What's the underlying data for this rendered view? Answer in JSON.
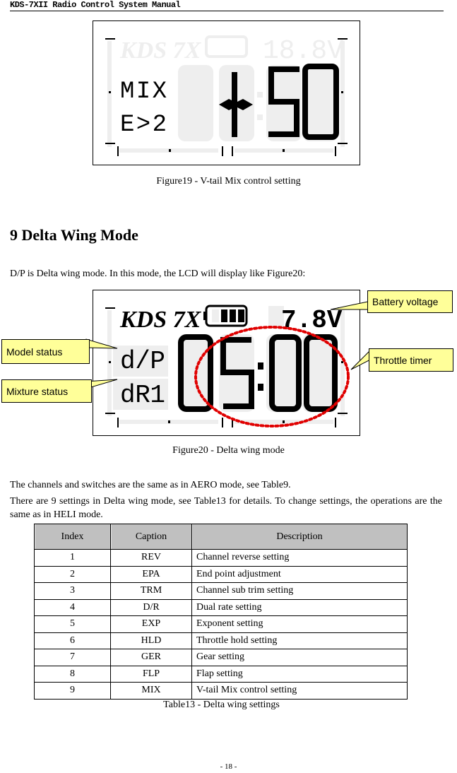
{
  "header": {
    "title": "KDS-7XII Radio Control System Manual"
  },
  "figure19": {
    "lcd": {
      "brand": "KDS 7X",
      "voltage_ghost": "18.8V",
      "line1": "MIX",
      "line2": "E>2",
      "timer": "-:50"
    },
    "caption": "Figure19 - V-tail Mix control setting"
  },
  "section": {
    "heading": "9 Delta Wing Mode",
    "intro": "D/P is Delta wing mode. In this mode, the LCD will display like Figure20:"
  },
  "figure20": {
    "lcd": {
      "brand": "KDS 7X",
      "voltage": "7.8V",
      "line1": "d/P",
      "line2": "dR1",
      "timer": "05:00",
      "battery_level_bars": 3
    },
    "callouts": {
      "battery_voltage": "Battery voltage",
      "model_status": "Model status",
      "throttle_timer": "Throttle timer",
      "mixture_status": "Mixture status"
    },
    "highlight_color": "#e00000",
    "callout_color": "#ffff99",
    "caption": "Figure20 - Delta wing mode"
  },
  "body": {
    "p1": "The channels and switches are the same as in AERO mode, see Table9.",
    "p2": "There are 9 settings in Delta wing mode, see Table13 for details. To change settings, the operations are the same as in HELI mode."
  },
  "table13": {
    "headers": [
      "Index",
      "Caption",
      "Description"
    ],
    "rows": [
      [
        "1",
        "REV",
        "Channel reverse setting"
      ],
      [
        "2",
        "EPA",
        "End point adjustment"
      ],
      [
        "3",
        "TRM",
        "Channel sub trim setting"
      ],
      [
        "4",
        "D/R",
        "Dual rate setting"
      ],
      [
        "5",
        "EXP",
        "Exponent setting"
      ],
      [
        "6",
        "HLD",
        "Throttle hold setting"
      ],
      [
        "7",
        "GER",
        "Gear setting"
      ],
      [
        "8",
        "FLP",
        "Flap setting"
      ],
      [
        "9",
        "MIX",
        "V-tail Mix control setting"
      ]
    ],
    "caption": "Table13 - Delta wing settings"
  },
  "footer": {
    "page_number": "- 18 -"
  }
}
